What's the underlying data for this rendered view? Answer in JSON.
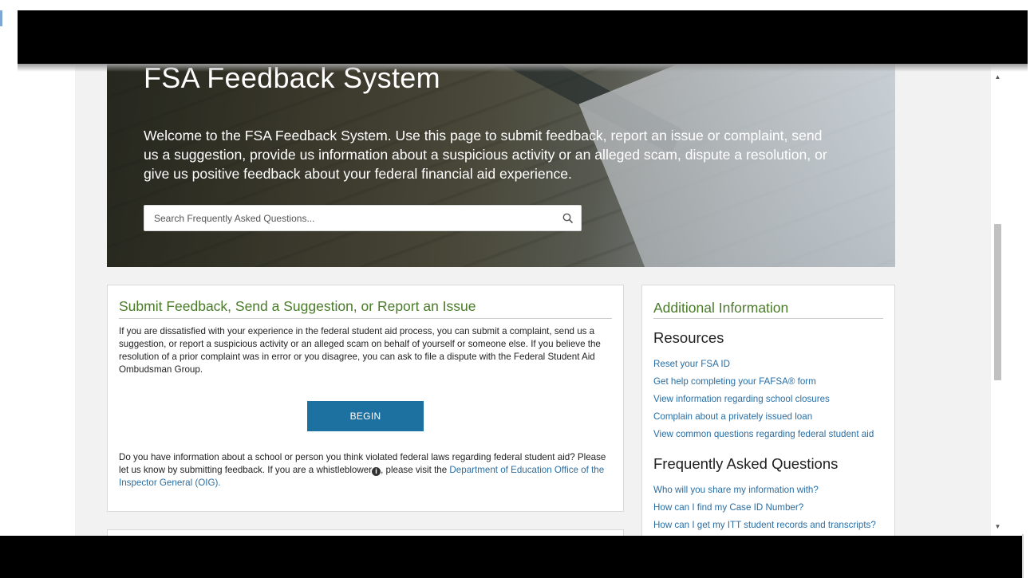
{
  "hero": {
    "title": "FSA Feedback System",
    "intro": "Welcome to the FSA Feedback System. Use this page to submit feedback, report an issue or complaint, send us a suggestion, provide us information about a suspicious activity or an alleged scam, dispute a resolution, or give us positive feedback about your federal financial aid experience.",
    "search_placeholder": "Search Frequently Asked Questions...",
    "search_icon": "search-icon"
  },
  "submit_card": {
    "title": "Submit Feedback, Send a Suggestion, or Report an Issue",
    "paragraph1": "If you are dissatisfied with your experience in the federal student aid process, you can submit a complaint, send us a suggestion, or report a suspicious activity or an alleged scam on behalf of yourself or someone else. If you believe the resolution of a prior complaint was in error or you disagree, you can ask to file a dispute with the Federal Student Aid Ombudsman Group.",
    "begin_label": "BEGIN",
    "paragraph2_start": "Do you have information about a school or person you think violated federal laws regarding federal student aid? Please let us know by submitting feedback. If you are a whistleblower",
    "info_icon": "info-icon",
    "info_glyph": "i",
    "paragraph2_mid": ", please visit the ",
    "oig_link": "Department of Education Office of the Inspector General (OIG).",
    "accent_color": "#4a7a2a",
    "button_color": "#1c71a0"
  },
  "additional": {
    "title": "Additional Information",
    "resources_heading": "Resources",
    "resources": [
      "Reset your FSA ID",
      "Get help completing your FAFSA® form",
      "View information regarding school closures",
      "Complain about a privately issued loan",
      "View common questions regarding federal student aid"
    ],
    "faq_heading": "Frequently Asked Questions",
    "faqs": [
      "Who will you share my information with?",
      "How can I find my Case ID Number?",
      "How can I get my ITT student records and transcripts?"
    ],
    "link_color": "#2a6ea3"
  },
  "scrollbar": {
    "up_arrow": "▲",
    "down_arrow": "▼"
  }
}
